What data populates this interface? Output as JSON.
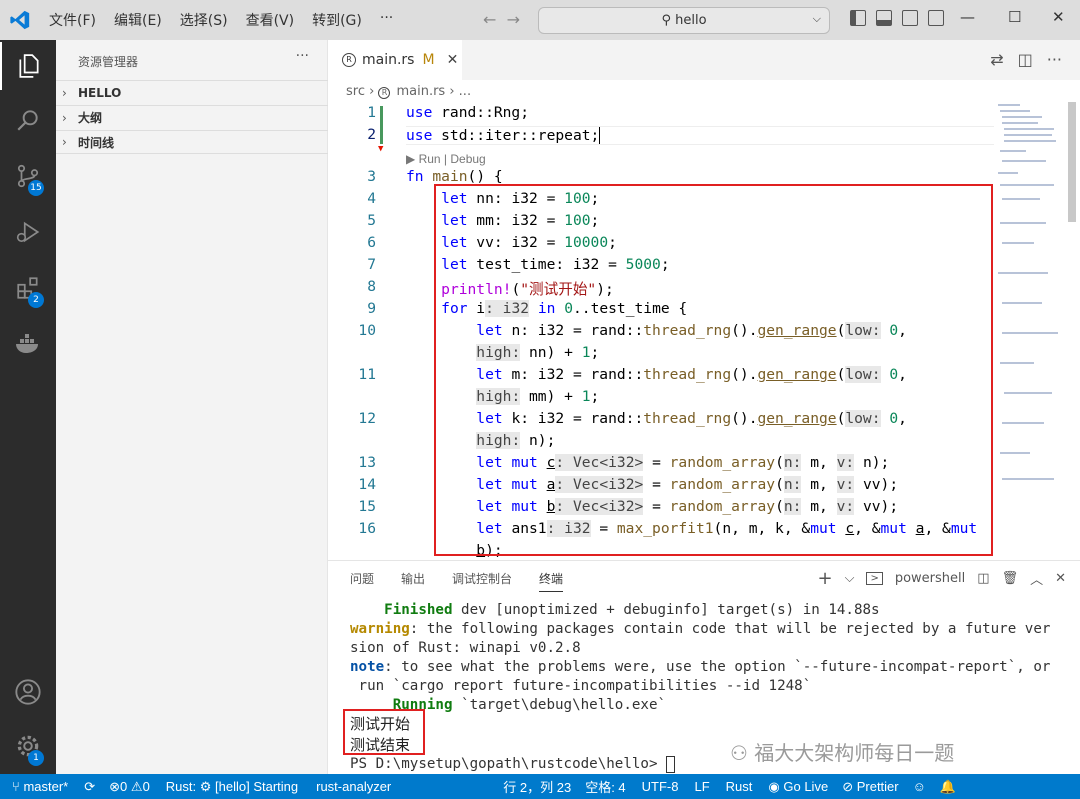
{
  "menu": [
    "文件(F)",
    "编辑(E)",
    "选择(S)",
    "查看(V)",
    "转到(G)",
    "···"
  ],
  "search": {
    "text": "hello"
  },
  "sidebar": {
    "title": "资源管理器",
    "more": "···",
    "sections": [
      "HELLO",
      "大纲",
      "时间线"
    ]
  },
  "activity": {
    "scm_badge": "15",
    "ext_badge": "2",
    "settings_badge": "1"
  },
  "tab": {
    "name": "main.rs",
    "modified": "M"
  },
  "breadcrumb": {
    "folder": "src",
    "sep": "›",
    "file": "main.rs",
    "rest": "› ..."
  },
  "codelens": "▶ Run | Debug",
  "line_numbers": [
    "1",
    "2",
    "",
    "3",
    "4",
    "5",
    "6",
    "7",
    "8",
    "9",
    "10",
    "",
    "11",
    "",
    "12",
    "",
    "13",
    "14",
    "15",
    "16",
    ""
  ],
  "panel": {
    "tabs": [
      "问题",
      "输出",
      "调试控制台",
      "终端"
    ],
    "shell": "powershell"
  },
  "terminal": {
    "l1_a": "    Finished",
    "l1_b": " dev [unoptimized + debuginfo] target(s) in 14.88s",
    "l2_a": "warning",
    "l2_b": ": the following packages contain code that will be rejected by a future ver",
    "l3": "sion of Rust: winapi v0.2.8",
    "l4_a": "note",
    "l4_b": ": to see what the problems were, use the option `--future-incompat-report`, or",
    "l5": " run `cargo report future-incompatibilities --id 1248`",
    "l6_a": "     Running",
    "l6_b": " `target\\debug\\hello.exe`",
    "out1": "测试开始",
    "out2": "测试结束",
    "prompt": "PS D:\\mysetup\\gopath\\rustcode\\hello> "
  },
  "watermark": "福大大架构师每日一题",
  "status": {
    "branch": "master*",
    "errors": "0",
    "warnings": "0",
    "rust": "Rust: ⚙ [hello] Starting",
    "analyzer": "rust-analyzer",
    "position": "行 2，列 23",
    "spaces": "空格: 4",
    "encoding": "UTF-8",
    "eol": "LF",
    "lang": "Rust",
    "golive": "Go Live",
    "prettier": "Prettier"
  },
  "colors": {
    "accent": "#007acc",
    "highlight_box": "#e02020"
  }
}
